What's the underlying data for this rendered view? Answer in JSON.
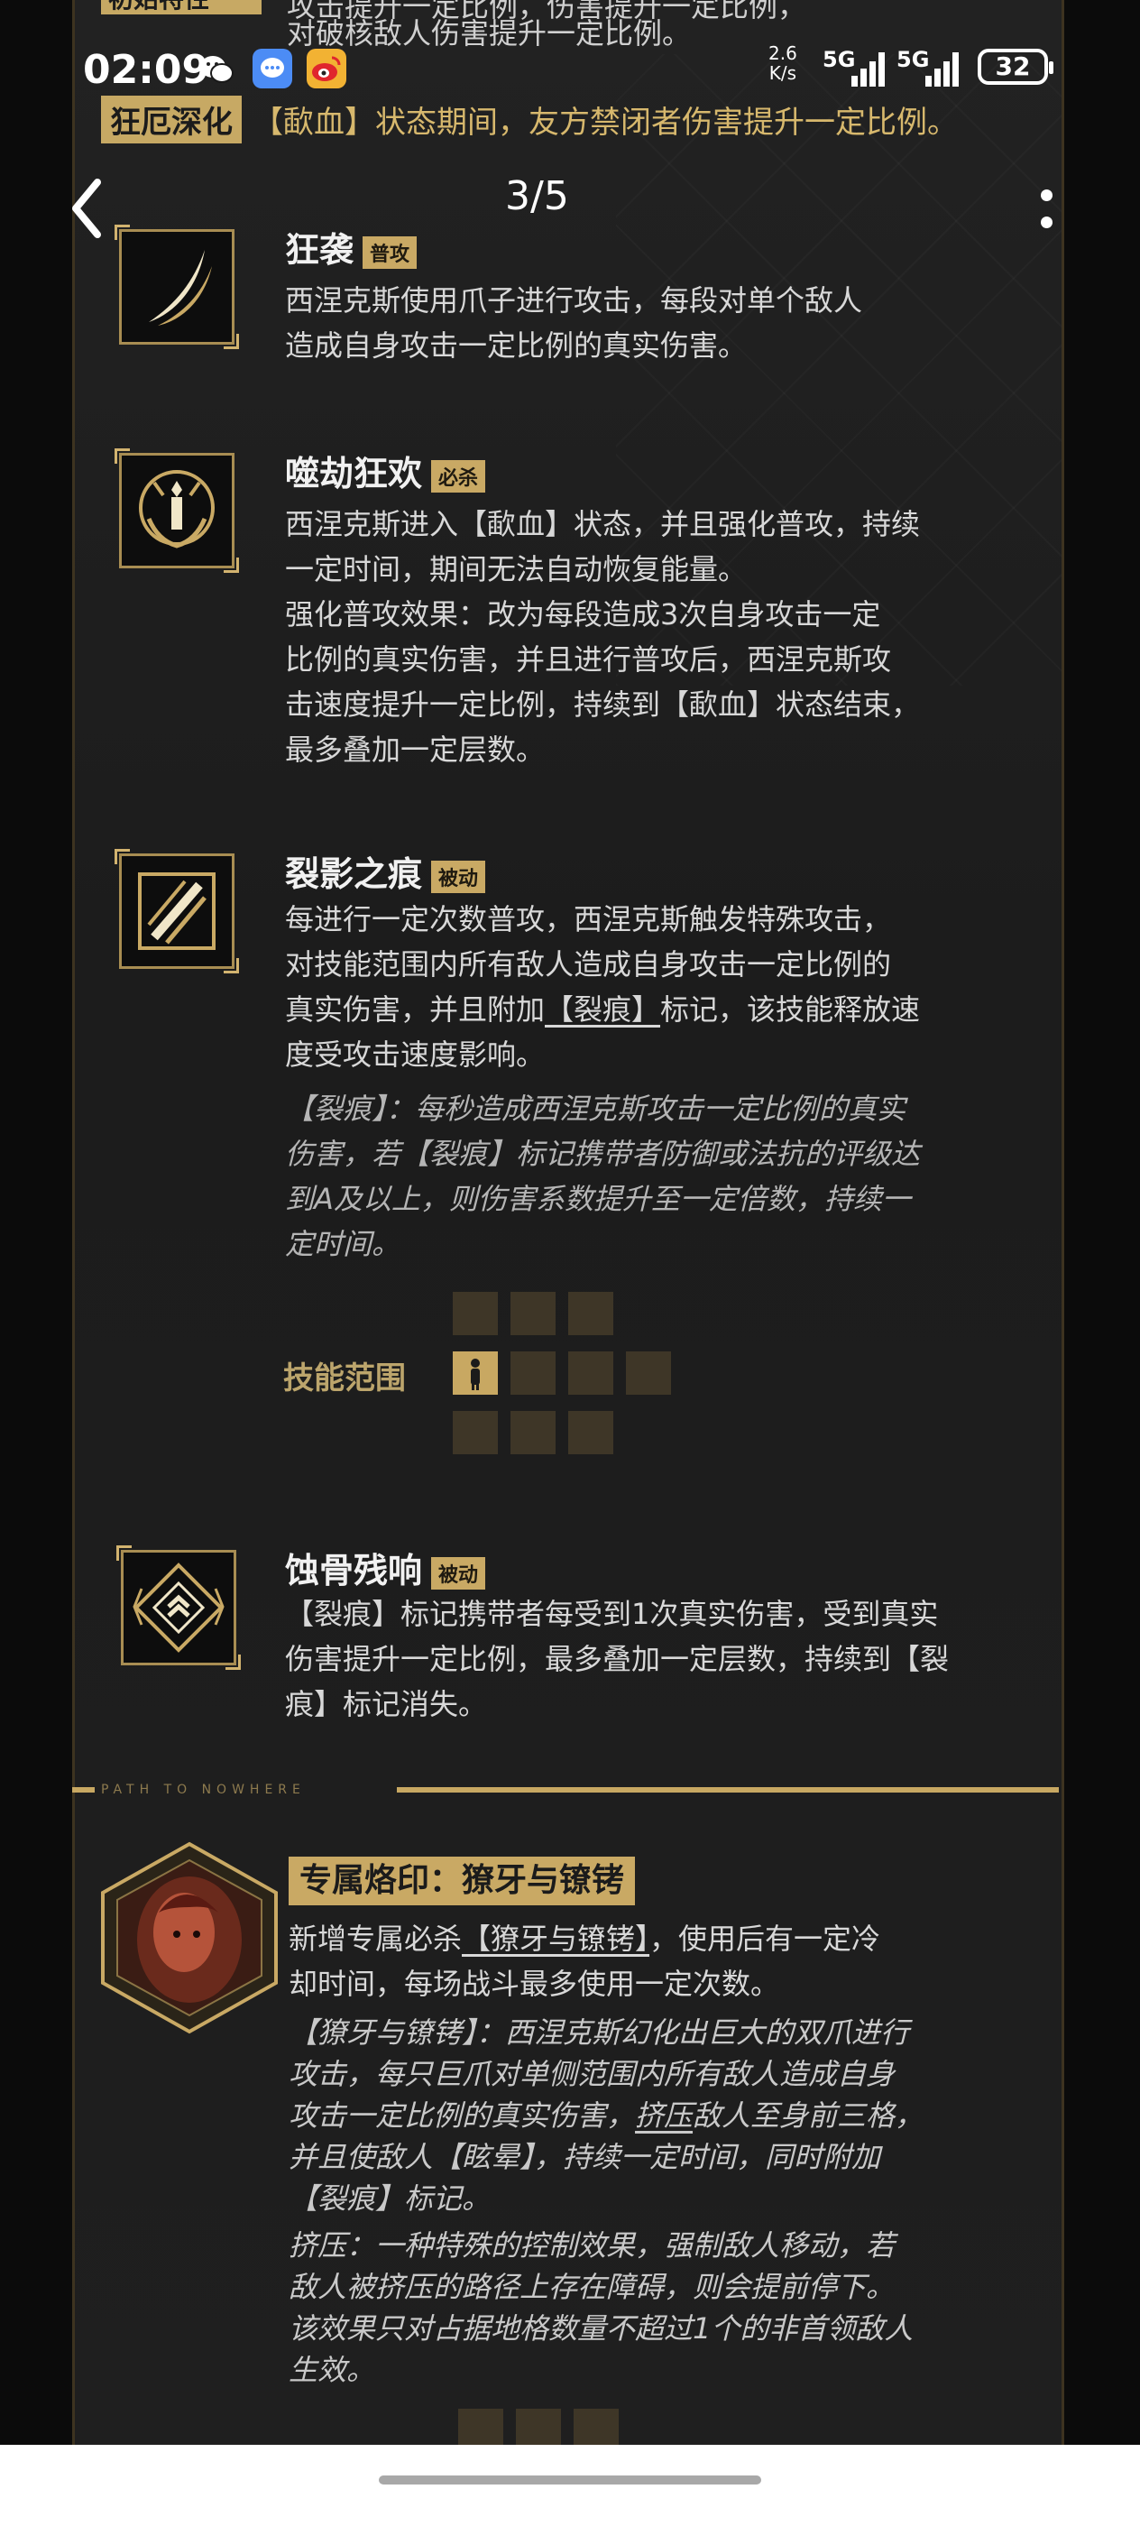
{
  "status_bar": {
    "time": "02:09",
    "net_speed_value": "2.6",
    "net_speed_unit": "K/s",
    "sim1": "5G",
    "sim2": "5G",
    "battery": "32"
  },
  "header": {
    "page_indicator": "3/5"
  },
  "top_cut": {
    "badge": "初始特性",
    "line1": "攻击提升一定比例，伤害提升一定比例，",
    "line2": "对破核敌人伤害提升一定比例。"
  },
  "deepening": {
    "tag": "狂厄深化",
    "text": "【歃血】状态期间，友方禁闭者伤害提升一定比例。"
  },
  "skills": [
    {
      "name": "狂袭",
      "tag": "普攻",
      "icon": "claw-slash-icon",
      "desc": [
        "西涅克斯使用爪子进行攻击，每段对单个敌人",
        "造成自身攻击一定比例的真实伤害。"
      ]
    },
    {
      "name": "噬劫狂欢",
      "tag": "必杀",
      "icon": "berserk-figure-icon",
      "desc": [
        "西涅克斯进入【歃血】状态，并且强化普攻，持续",
        "一定时间，期间无法自动恢复能量。",
        "强化普攻效果：改为每段造成3次自身攻击一定",
        "比例的真实伤害，并且进行普攻后，西涅克斯攻",
        "击速度提升一定比例，持续到【歃血】状态结束，",
        "最多叠加一定层数。"
      ]
    },
    {
      "name": "裂影之痕",
      "tag": "被动",
      "icon": "shadow-rift-icon",
      "desc": [
        "每进行一定次数普攻，西涅克斯触发特殊攻击，",
        "对技能范围内所有敌人造成自身攻击一定比例的",
        "真实伤害，并且附加",
        "【裂痕】",
        "标记，该技能释放速",
        "度受攻击速度影响。"
      ],
      "note": [
        "【裂痕】：每秒造成西涅克斯攻击一定比例的真实",
        "伤害，若【裂痕】标记携带者防御或法抗的评级达",
        "到A及以上，则伤害系数提升至一定倍数，持续一",
        "定时间。"
      ],
      "range_label": "技能范围"
    },
    {
      "name": "蚀骨残响",
      "tag": "被动",
      "icon": "bone-echo-icon",
      "desc": [
        "【裂痕】标记携带者每受到1次真实伤害，受到真实",
        "伤害提升一定比例，最多叠加一定层数，持续到【裂",
        "痕】标记消失。"
      ]
    }
  ],
  "divider": {
    "text": "PATH TO NOWHERE"
  },
  "exclusive": {
    "title": "专属烙印：獠牙与镣铐",
    "intro": [
      "新增专属必杀",
      "【獠牙与镣铐】",
      "，使用后有一定冷",
      "却时间，每场战斗最多使用一定次数。"
    ],
    "detail": [
      "【獠牙与镣铐】：西涅克斯幻化出巨大的双爪进行",
      "攻击，每只巨爪对单侧范围内所有敌人造成自身",
      "攻击一定比例的真实伤害，",
      "挤压",
      "敌人至身前三格，",
      "并且使敌人【眩晕】，持续一定时间，同时附加",
      "【裂痕】标记。"
    ],
    "squeeze": [
      "挤压：一种特殊的控制效果，强制敌人移动，若",
      "敌人被挤压的路径上存在障碍，则会提前停下。",
      "该效果只对占据地格数量不超过1个的非首领敌人",
      "生效。"
    ]
  },
  "colors": {
    "gold": "#c9a964",
    "panel_bg": "#1f1f1f",
    "text": "#d8d8d8"
  }
}
